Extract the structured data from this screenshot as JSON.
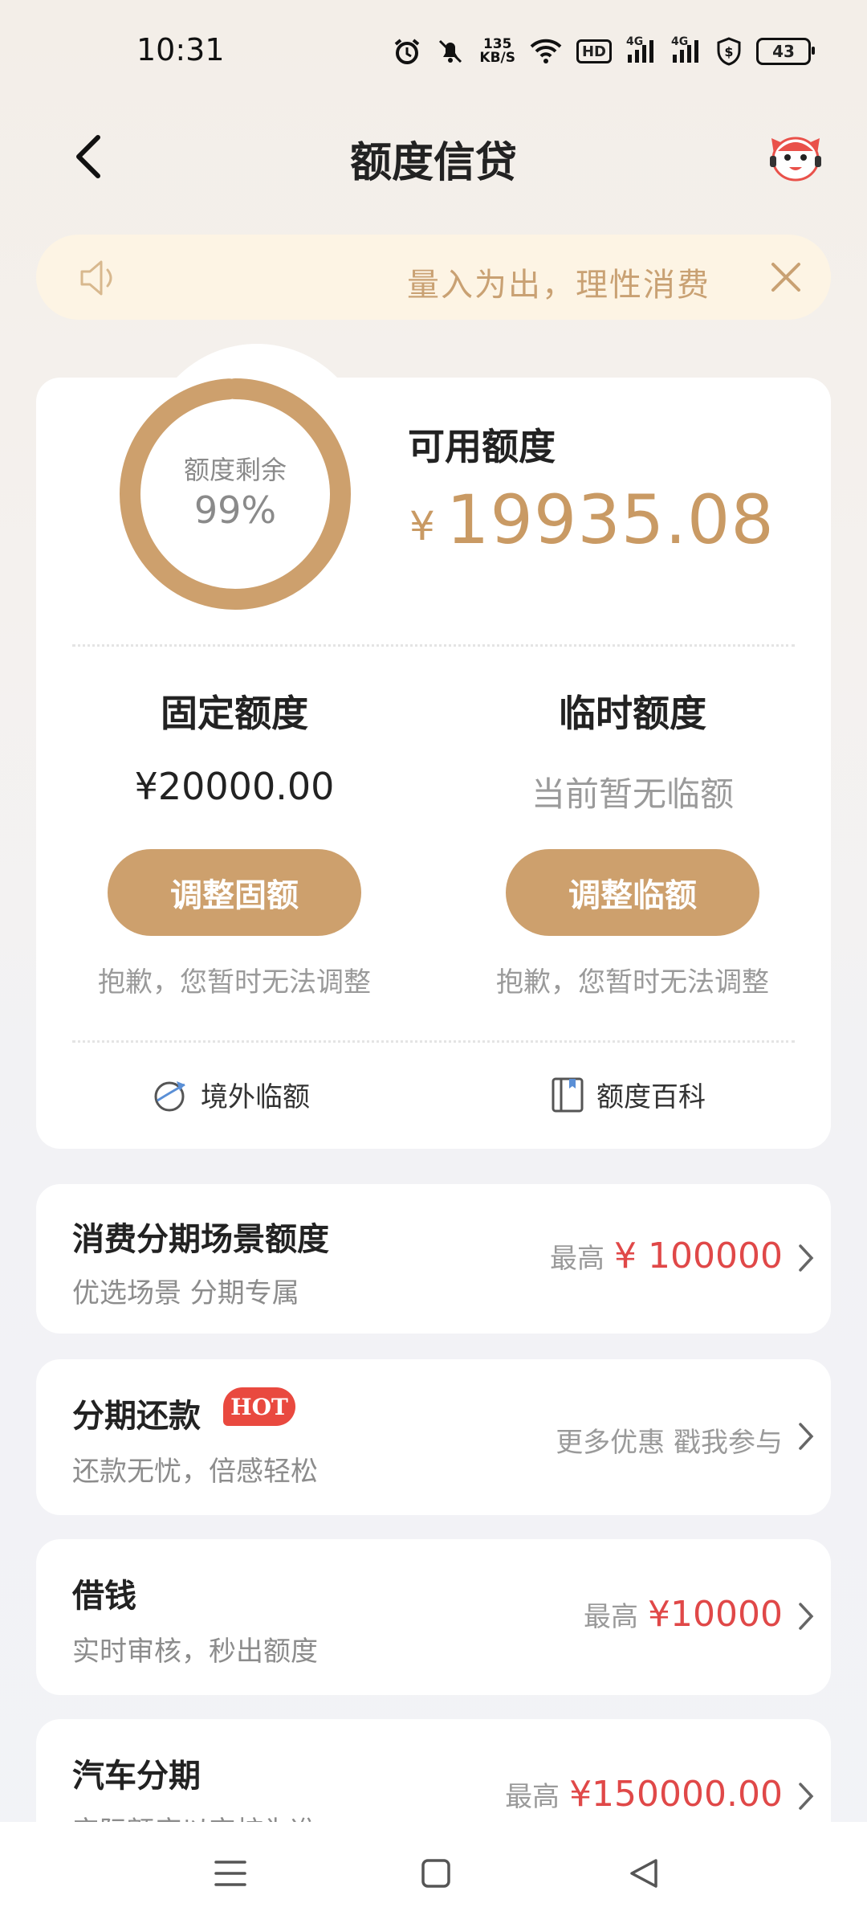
{
  "status_bar": {
    "time": "10:31",
    "net_speed_value": "135",
    "net_speed_unit": "KB/S",
    "hd_label": "HD",
    "signal_labels": [
      "4G",
      "4G"
    ],
    "battery": "43",
    "icons": [
      "alarm-icon",
      "mute-icon",
      "wifi-icon",
      "hd-icon",
      "signal-icon",
      "signal-icon",
      "shield-dollar-icon",
      "battery-icon"
    ]
  },
  "header": {
    "title": "额度信贷",
    "back_icon": "chevron-left-icon",
    "mascot_icon": "mascot-icon"
  },
  "notice": {
    "text": "量入为出，理性消费",
    "icon": "speaker-icon",
    "close_icon": "close-icon"
  },
  "credit": {
    "ring_label": "额度剩余",
    "ring_percent": "99%",
    "ring_fraction": 0.99,
    "available_label": "可用额度",
    "available_currency": "¥",
    "available_amount": "19935.08",
    "fixed": {
      "title": "固定额度",
      "value": "¥20000.00",
      "button": "调整固额",
      "note": "抱歉，您暂时无法调整"
    },
    "temp": {
      "title": "临时额度",
      "value": "当前暂无临额",
      "button": "调整临额",
      "note": "抱歉，您暂时无法调整"
    },
    "links": [
      {
        "label": "境外临额",
        "icon": "globe-plane-icon"
      },
      {
        "label": "额度百科",
        "icon": "book-icon"
      }
    ]
  },
  "list": [
    {
      "title": "消费分期场景额度",
      "subtitle": "优选场景 分期专属",
      "prefix": "最高",
      "amount": "¥ 100000"
    },
    {
      "title": "分期还款",
      "badge": "HOT",
      "subtitle": "还款无忧，倍感轻松",
      "right_text": "更多优惠 戳我参与"
    },
    {
      "title": "借钱",
      "subtitle": "实时审核，秒出额度",
      "prefix": "最高",
      "amount": "¥10000"
    },
    {
      "title": "汽车分期",
      "subtitle": "实际额度以审核为准",
      "prefix": "最高",
      "amount": "¥150000.00"
    }
  ],
  "colors": {
    "accent": "#cda06d",
    "amount_red": "#e04848",
    "notice_bg": "#fdf4e4"
  },
  "nav": {
    "icons": [
      "menu-icon",
      "home-square-icon",
      "back-triangle-icon"
    ]
  }
}
